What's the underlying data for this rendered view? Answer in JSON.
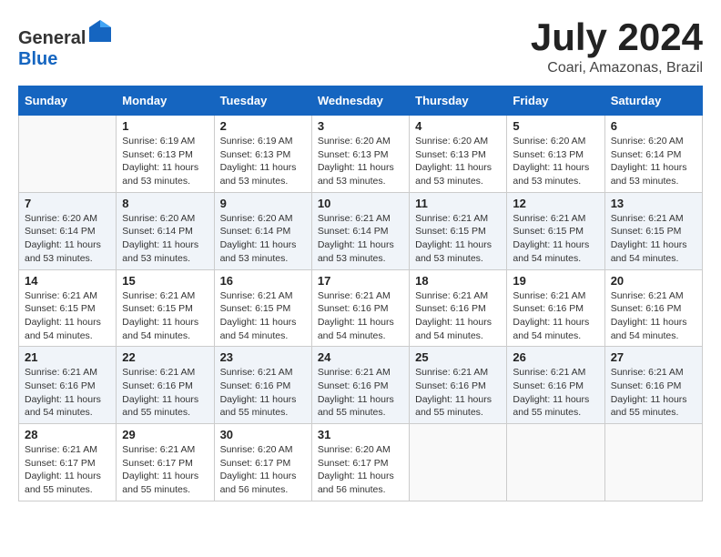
{
  "header": {
    "logo": {
      "text_general": "General",
      "text_blue": "Blue"
    },
    "title": "July 2024",
    "location": "Coari, Amazonas, Brazil"
  },
  "weekdays": [
    "Sunday",
    "Monday",
    "Tuesday",
    "Wednesday",
    "Thursday",
    "Friday",
    "Saturday"
  ],
  "weeks": [
    [
      {
        "day": "",
        "sunrise": "",
        "sunset": "",
        "daylight": ""
      },
      {
        "day": "1",
        "sunrise": "Sunrise: 6:19 AM",
        "sunset": "Sunset: 6:13 PM",
        "daylight": "Daylight: 11 hours and 53 minutes."
      },
      {
        "day": "2",
        "sunrise": "Sunrise: 6:19 AM",
        "sunset": "Sunset: 6:13 PM",
        "daylight": "Daylight: 11 hours and 53 minutes."
      },
      {
        "day": "3",
        "sunrise": "Sunrise: 6:20 AM",
        "sunset": "Sunset: 6:13 PM",
        "daylight": "Daylight: 11 hours and 53 minutes."
      },
      {
        "day": "4",
        "sunrise": "Sunrise: 6:20 AM",
        "sunset": "Sunset: 6:13 PM",
        "daylight": "Daylight: 11 hours and 53 minutes."
      },
      {
        "day": "5",
        "sunrise": "Sunrise: 6:20 AM",
        "sunset": "Sunset: 6:13 PM",
        "daylight": "Daylight: 11 hours and 53 minutes."
      },
      {
        "day": "6",
        "sunrise": "Sunrise: 6:20 AM",
        "sunset": "Sunset: 6:14 PM",
        "daylight": "Daylight: 11 hours and 53 minutes."
      }
    ],
    [
      {
        "day": "7",
        "sunrise": "Sunrise: 6:20 AM",
        "sunset": "Sunset: 6:14 PM",
        "daylight": "Daylight: 11 hours and 53 minutes."
      },
      {
        "day": "8",
        "sunrise": "Sunrise: 6:20 AM",
        "sunset": "Sunset: 6:14 PM",
        "daylight": "Daylight: 11 hours and 53 minutes."
      },
      {
        "day": "9",
        "sunrise": "Sunrise: 6:20 AM",
        "sunset": "Sunset: 6:14 PM",
        "daylight": "Daylight: 11 hours and 53 minutes."
      },
      {
        "day": "10",
        "sunrise": "Sunrise: 6:21 AM",
        "sunset": "Sunset: 6:14 PM",
        "daylight": "Daylight: 11 hours and 53 minutes."
      },
      {
        "day": "11",
        "sunrise": "Sunrise: 6:21 AM",
        "sunset": "Sunset: 6:15 PM",
        "daylight": "Daylight: 11 hours and 53 minutes."
      },
      {
        "day": "12",
        "sunrise": "Sunrise: 6:21 AM",
        "sunset": "Sunset: 6:15 PM",
        "daylight": "Daylight: 11 hours and 54 minutes."
      },
      {
        "day": "13",
        "sunrise": "Sunrise: 6:21 AM",
        "sunset": "Sunset: 6:15 PM",
        "daylight": "Daylight: 11 hours and 54 minutes."
      }
    ],
    [
      {
        "day": "14",
        "sunrise": "Sunrise: 6:21 AM",
        "sunset": "Sunset: 6:15 PM",
        "daylight": "Daylight: 11 hours and 54 minutes."
      },
      {
        "day": "15",
        "sunrise": "Sunrise: 6:21 AM",
        "sunset": "Sunset: 6:15 PM",
        "daylight": "Daylight: 11 hours and 54 minutes."
      },
      {
        "day": "16",
        "sunrise": "Sunrise: 6:21 AM",
        "sunset": "Sunset: 6:15 PM",
        "daylight": "Daylight: 11 hours and 54 minutes."
      },
      {
        "day": "17",
        "sunrise": "Sunrise: 6:21 AM",
        "sunset": "Sunset: 6:16 PM",
        "daylight": "Daylight: 11 hours and 54 minutes."
      },
      {
        "day": "18",
        "sunrise": "Sunrise: 6:21 AM",
        "sunset": "Sunset: 6:16 PM",
        "daylight": "Daylight: 11 hours and 54 minutes."
      },
      {
        "day": "19",
        "sunrise": "Sunrise: 6:21 AM",
        "sunset": "Sunset: 6:16 PM",
        "daylight": "Daylight: 11 hours and 54 minutes."
      },
      {
        "day": "20",
        "sunrise": "Sunrise: 6:21 AM",
        "sunset": "Sunset: 6:16 PM",
        "daylight": "Daylight: 11 hours and 54 minutes."
      }
    ],
    [
      {
        "day": "21",
        "sunrise": "Sunrise: 6:21 AM",
        "sunset": "Sunset: 6:16 PM",
        "daylight": "Daylight: 11 hours and 54 minutes."
      },
      {
        "day": "22",
        "sunrise": "Sunrise: 6:21 AM",
        "sunset": "Sunset: 6:16 PM",
        "daylight": "Daylight: 11 hours and 55 minutes."
      },
      {
        "day": "23",
        "sunrise": "Sunrise: 6:21 AM",
        "sunset": "Sunset: 6:16 PM",
        "daylight": "Daylight: 11 hours and 55 minutes."
      },
      {
        "day": "24",
        "sunrise": "Sunrise: 6:21 AM",
        "sunset": "Sunset: 6:16 PM",
        "daylight": "Daylight: 11 hours and 55 minutes."
      },
      {
        "day": "25",
        "sunrise": "Sunrise: 6:21 AM",
        "sunset": "Sunset: 6:16 PM",
        "daylight": "Daylight: 11 hours and 55 minutes."
      },
      {
        "day": "26",
        "sunrise": "Sunrise: 6:21 AM",
        "sunset": "Sunset: 6:16 PM",
        "daylight": "Daylight: 11 hours and 55 minutes."
      },
      {
        "day": "27",
        "sunrise": "Sunrise: 6:21 AM",
        "sunset": "Sunset: 6:16 PM",
        "daylight": "Daylight: 11 hours and 55 minutes."
      }
    ],
    [
      {
        "day": "28",
        "sunrise": "Sunrise: 6:21 AM",
        "sunset": "Sunset: 6:17 PM",
        "daylight": "Daylight: 11 hours and 55 minutes."
      },
      {
        "day": "29",
        "sunrise": "Sunrise: 6:21 AM",
        "sunset": "Sunset: 6:17 PM",
        "daylight": "Daylight: 11 hours and 55 minutes."
      },
      {
        "day": "30",
        "sunrise": "Sunrise: 6:20 AM",
        "sunset": "Sunset: 6:17 PM",
        "daylight": "Daylight: 11 hours and 56 minutes."
      },
      {
        "day": "31",
        "sunrise": "Sunrise: 6:20 AM",
        "sunset": "Sunset: 6:17 PM",
        "daylight": "Daylight: 11 hours and 56 minutes."
      },
      {
        "day": "",
        "sunrise": "",
        "sunset": "",
        "daylight": ""
      },
      {
        "day": "",
        "sunrise": "",
        "sunset": "",
        "daylight": ""
      },
      {
        "day": "",
        "sunrise": "",
        "sunset": "",
        "daylight": ""
      }
    ]
  ]
}
